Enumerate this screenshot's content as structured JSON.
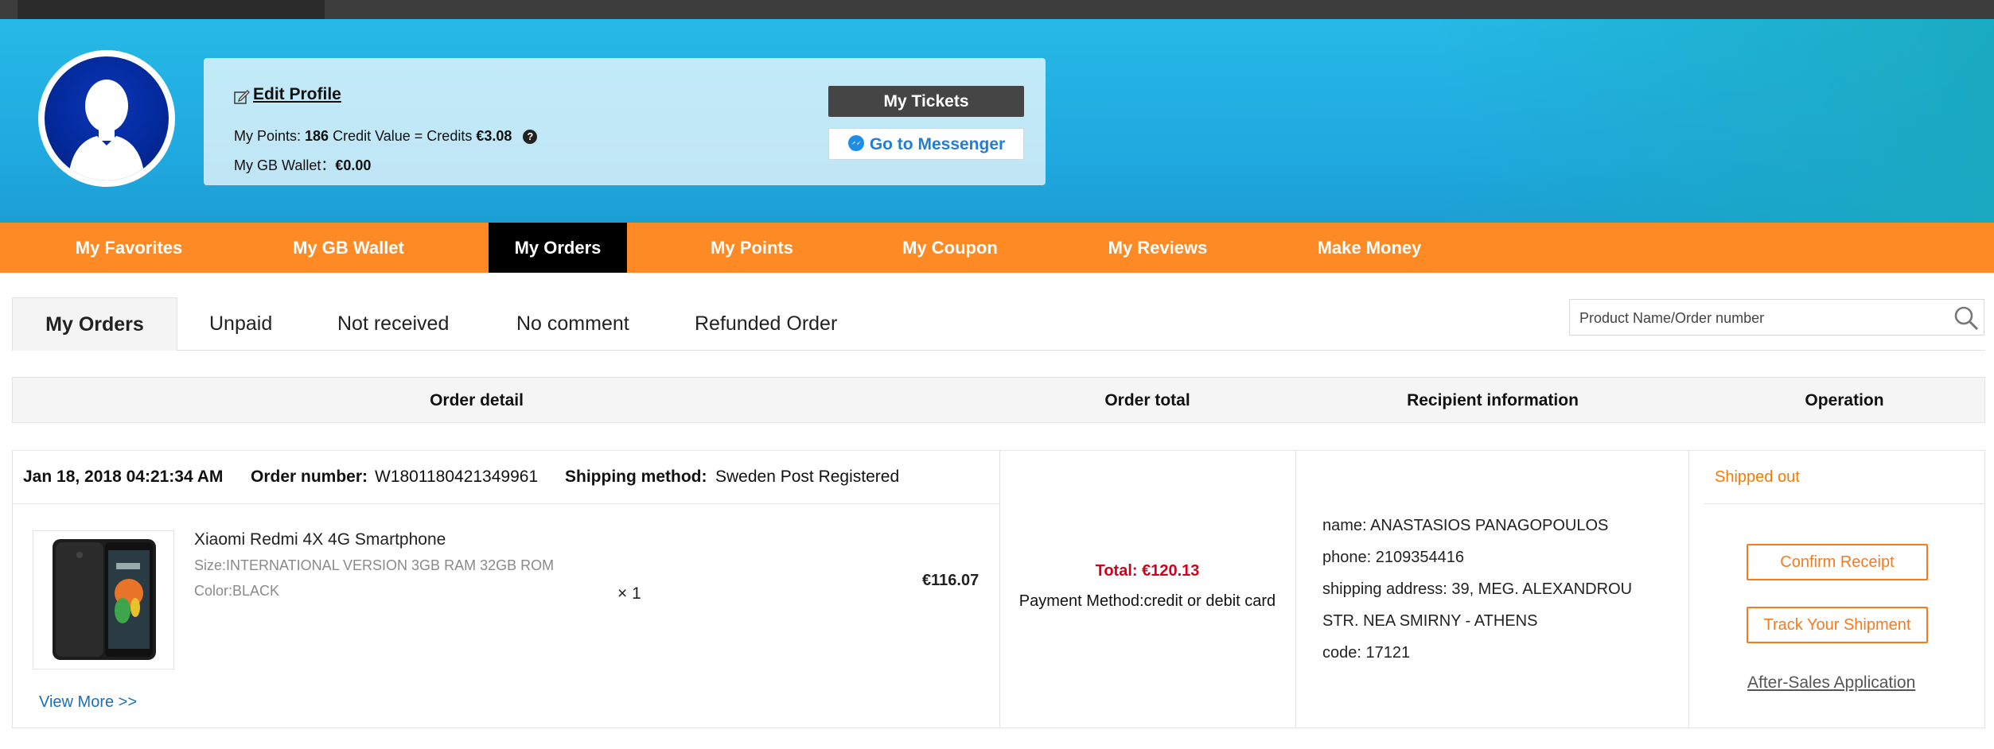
{
  "profile": {
    "edit_profile": "Edit Profile",
    "points_label": "My Points: ",
    "points_value": "186",
    "credit_label": " Credit Value = Credits ",
    "credit_value": "€3.08",
    "help_glyph": "?",
    "wallet_label": "My GB Wallet：",
    "wallet_value": "€0.00",
    "tickets_button": "My Tickets",
    "messenger_button": "Go to Messenger"
  },
  "nav": {
    "items": [
      {
        "label": "My Favorites"
      },
      {
        "label": "My GB Wallet"
      },
      {
        "label": "My Orders",
        "active": true
      },
      {
        "label": "My Points"
      },
      {
        "label": "My Coupon"
      },
      {
        "label": "My Reviews"
      },
      {
        "label": "Make Money"
      }
    ]
  },
  "tabs": {
    "items": [
      {
        "label": "My Orders",
        "active": true
      },
      {
        "label": "Unpaid"
      },
      {
        "label": "Not received"
      },
      {
        "label": "No comment"
      },
      {
        "label": "Refunded Order"
      }
    ]
  },
  "search": {
    "placeholder": "Product Name/Order number",
    "value": ""
  },
  "table": {
    "headers": [
      "Order detail",
      "Order total",
      "Recipient information",
      "Operation"
    ]
  },
  "order": {
    "date": "Jan 18, 2018 04:21:34 AM",
    "order_number_label": "Order number:",
    "order_number": "W1801180421349961",
    "shipping_method_label": "Shipping method:",
    "shipping_method": "Sweden Post Registered",
    "product": {
      "name": "Xiaomi Redmi 4X 4G Smartphone",
      "size": "Size:INTERNATIONAL VERSION 3GB RAM 32GB ROM",
      "color": "Color:BLACK",
      "quantity": "× 1",
      "price": "€116.07"
    },
    "view_more": "View More >>",
    "total": "Total: €120.13",
    "payment_method": "Payment Method:credit or debit card",
    "recipient": {
      "name": "name: ANASTASIOS PANAGOPOULOS",
      "phone": "phone: 2109354416",
      "address_line1": "shipping address: 39, MEG. ALEXANDROU",
      "address_line2": "STR. NEA SMIRNY - ATHENS",
      "code": "code: 17121"
    },
    "status": "Shipped out",
    "confirm_button": "Confirm Receipt",
    "track_button": "Track Your Shipment",
    "after_sales": "After-Sales Application"
  },
  "colors": {
    "nav_orange": "#fd8a25",
    "active_black": "#000000",
    "status_orange": "#f57c00",
    "total_red": "#d0021b",
    "link_blue": "#1a6fb8",
    "banner_blue": "#1fa8df"
  },
  "icons": [
    "edit-icon",
    "help-icon",
    "messenger-icon",
    "search-icon",
    "avatar-silhouette"
  ]
}
